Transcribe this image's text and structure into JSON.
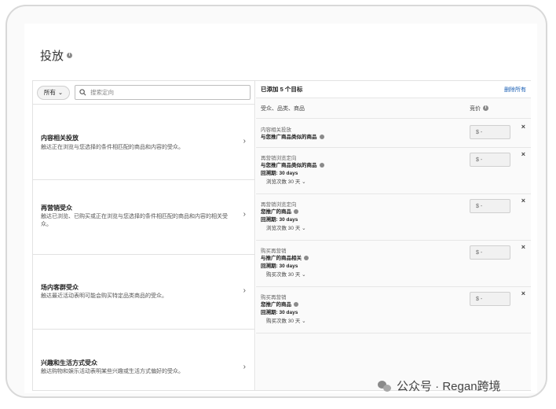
{
  "page": {
    "title": "投放"
  },
  "filter": {
    "scope_label": "所有",
    "search_placeholder": "搜索定向"
  },
  "categories": [
    {
      "title": "内容相关投放",
      "desc": "触达正在浏览与您选择的条件相匹配的商品和内容的受众。"
    },
    {
      "title": "再营销受众",
      "desc": "触达已浏览、已购买或正在浏览与您选择的条件相匹配的商品和内容的相关受众。"
    },
    {
      "title": "场内客群受众",
      "desc": "触达最近活动表明可能会购买特定品类商品的受众。"
    },
    {
      "title": "兴趣和生活方式受众",
      "desc": "触达购物和娱乐活动表明某些兴趣或生活方式偏好的受众。"
    }
  ],
  "targets_panel": {
    "count_label": "已添加 5 个目标",
    "remove_all": "删除所有",
    "col_audience": "受众、品类、商品",
    "col_bid": "竞价"
  },
  "targets": [
    {
      "type": "内容相关投放",
      "name": "与您推广商品类似的商品",
      "lookback": "",
      "sub": "",
      "price": "$  -"
    },
    {
      "type": "再营销浏览定向",
      "name": "与您推广商品类似的商品",
      "lookback": "回溯期: 30 days",
      "sub": "浏览次数 30 天",
      "price": "$  -"
    },
    {
      "type": "再营销浏览定向",
      "name": "您推广的商品",
      "lookback": "回溯期: 30 days",
      "sub": "浏览次数 30 天",
      "price": "$  -"
    },
    {
      "type": "购买再营销",
      "name": "与推广的商品相关",
      "lookback": "回溯期: 30 days",
      "sub": "购买次数 30 天",
      "price": "$  -"
    },
    {
      "type": "购买再营销",
      "name": "您推广的商品",
      "lookback": "回溯期: 30 days",
      "sub": "购买次数 30 天",
      "price": "$  -"
    }
  ],
  "watermark": {
    "text": "公众号 · Regan跨境"
  }
}
